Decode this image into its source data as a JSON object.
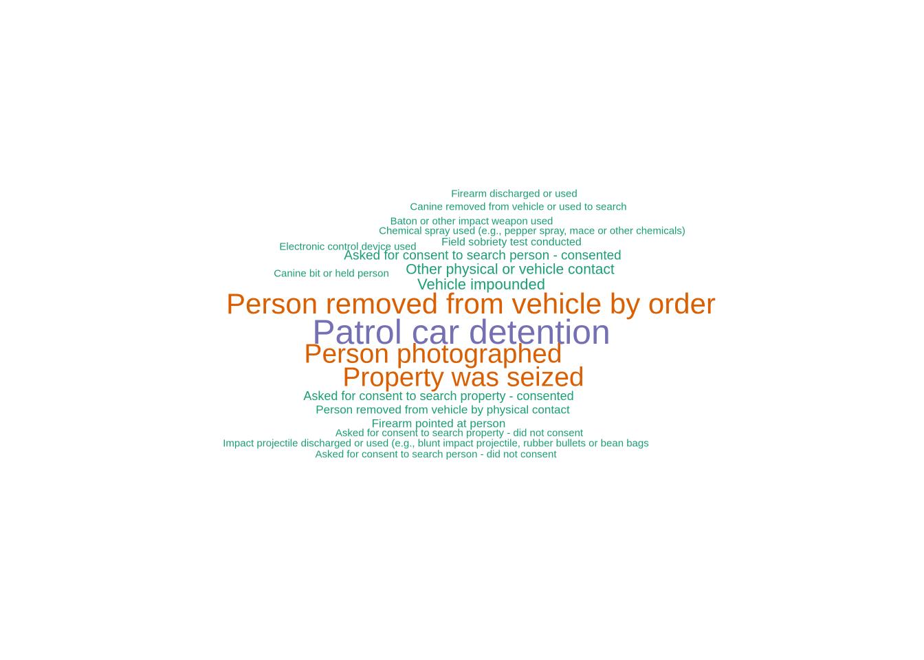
{
  "colors": {
    "tier_1": "#1b9e77",
    "tier_2": "#d95f02",
    "tier_3": "#7570b3",
    "background": "#ffffff"
  },
  "words": [
    {
      "text": "Firearm discharged or used",
      "tier": 1
    },
    {
      "text": "Canine removed from vehicle or used to search",
      "tier": 1
    },
    {
      "text": "Baton or other impact weapon used",
      "tier": 1
    },
    {
      "text": "Chemical spray used (e.g., pepper spray, mace or other chemicals)",
      "tier": 1
    },
    {
      "text": "Electronic control device used",
      "tier": 1
    },
    {
      "text": "Field sobriety test conducted",
      "tier": 1
    },
    {
      "text": "Asked for consent to search person - consented",
      "tier": 1
    },
    {
      "text": "Canine bit or held person",
      "tier": 1
    },
    {
      "text": "Other physical or vehicle contact",
      "tier": 1
    },
    {
      "text": "Vehicle impounded",
      "tier": 1
    },
    {
      "text": "Person removed from vehicle by order",
      "tier": 2
    },
    {
      "text": "Patrol car detention",
      "tier": 3
    },
    {
      "text": "Person photographed",
      "tier": 2
    },
    {
      "text": "Property was seized",
      "tier": 2
    },
    {
      "text": "Asked for consent to search property - consented",
      "tier": 1
    },
    {
      "text": "Person removed from vehicle by physical contact",
      "tier": 1
    },
    {
      "text": "Firearm pointed at person",
      "tier": 1
    },
    {
      "text": "Asked for consent to search property - did not consent",
      "tier": 1
    },
    {
      "text": "Impact projectile discharged or used (e.g., blunt impact projectile, rubber bullets or bean bags",
      "tier": 1
    },
    {
      "text": "Asked for consent to search person - did not consent",
      "tier": 1
    }
  ]
}
